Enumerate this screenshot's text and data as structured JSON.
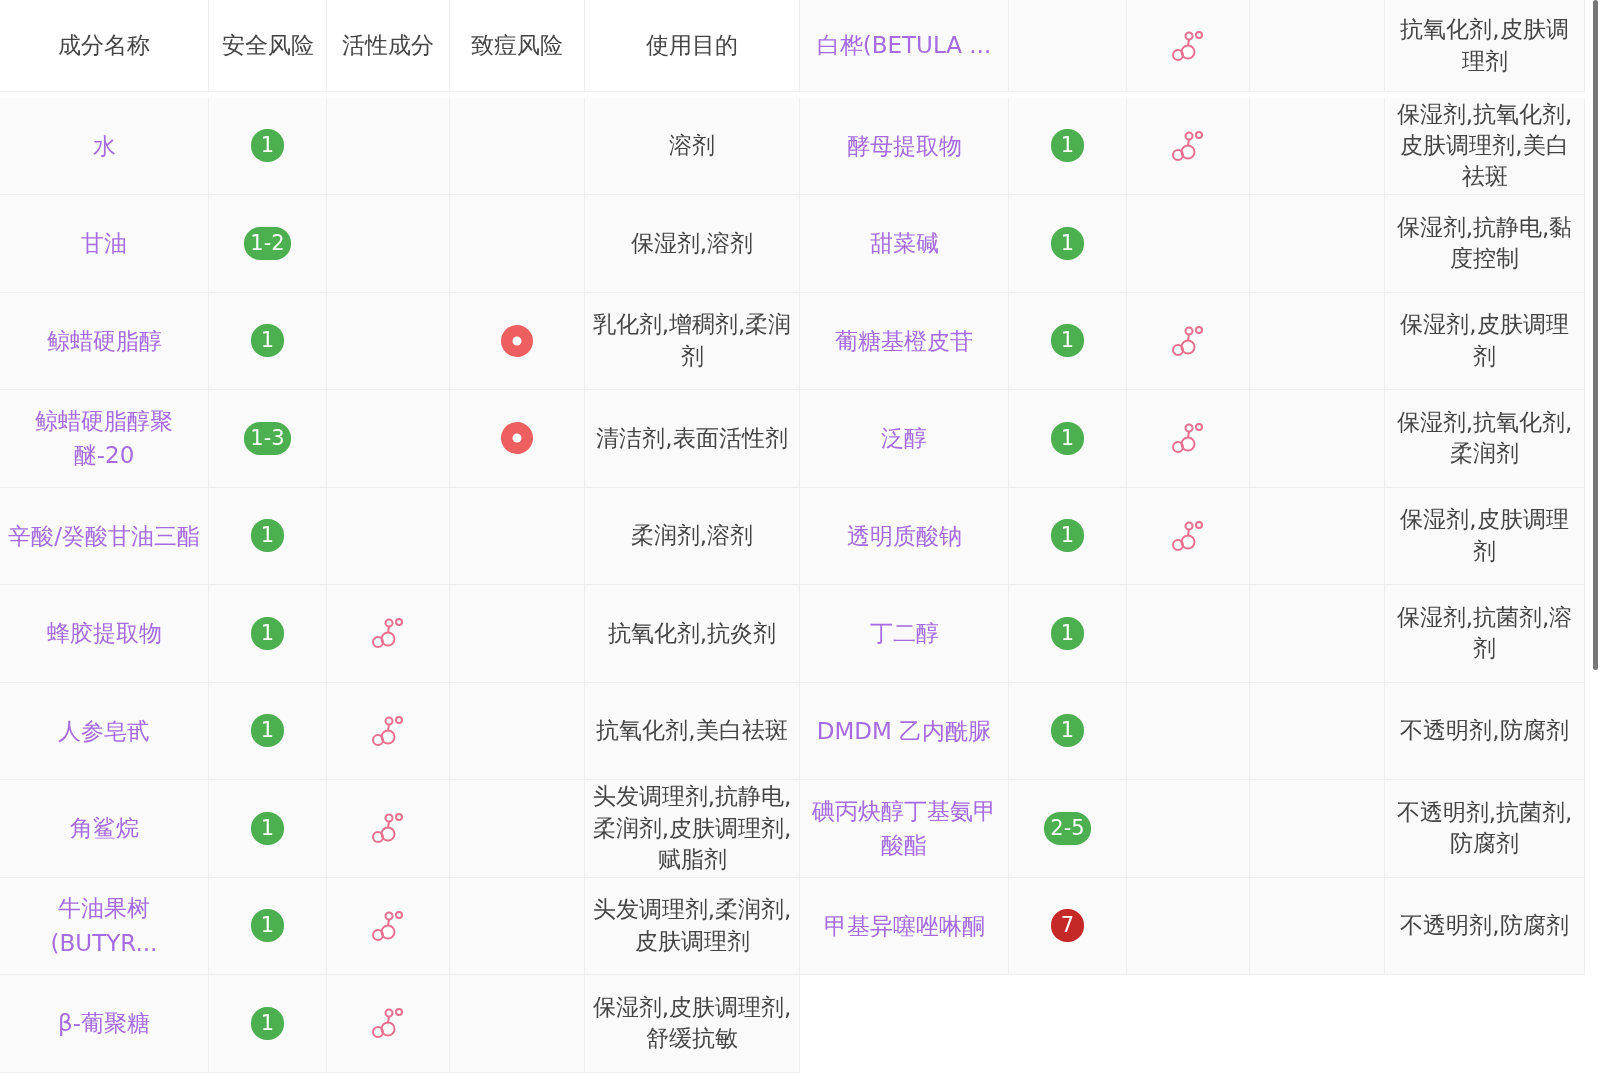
{
  "columns": [
    "成分名称",
    "安全风险",
    "活性成分",
    "致痘风险",
    "使用目的"
  ],
  "left_rows": [
    {
      "name": "水",
      "safety": {
        "text": "1",
        "color": "#4caf50"
      },
      "active": false,
      "acne_risk": false,
      "purpose": "溶剂"
    },
    {
      "name": "甘油",
      "safety": {
        "text": "1-2",
        "color": "#4caf50"
      },
      "active": false,
      "acne_risk": false,
      "purpose": "保湿剂,溶剂"
    },
    {
      "name": "鲸蜡硬脂醇",
      "safety": {
        "text": "1",
        "color": "#4caf50"
      },
      "active": false,
      "acne_risk": true,
      "purpose": "乳化剂,增稠剂,柔润剂"
    },
    {
      "name": "鲸蜡硬脂醇聚醚-20",
      "safety": {
        "text": "1-3",
        "color": "#4caf50"
      },
      "active": false,
      "acne_risk": true,
      "purpose": "清洁剂,表面活性剂"
    },
    {
      "name": "辛酸/癸酸甘油三酯",
      "safety": {
        "text": "1",
        "color": "#4caf50"
      },
      "active": false,
      "acne_risk": false,
      "purpose": "柔润剂,溶剂"
    },
    {
      "name": "蜂胶提取物",
      "safety": {
        "text": "1",
        "color": "#4caf50"
      },
      "active": true,
      "acne_risk": false,
      "purpose": "抗氧化剂,抗炎剂"
    },
    {
      "name": "人参皂甙",
      "safety": {
        "text": "1",
        "color": "#4caf50"
      },
      "active": true,
      "acne_risk": false,
      "purpose": "抗氧化剂,美白祛斑"
    },
    {
      "name": "角鲨烷",
      "safety": {
        "text": "1",
        "color": "#4caf50"
      },
      "active": true,
      "acne_risk": false,
      "purpose": "头发调理剂,抗静电,柔润剂,皮肤调理剂,赋脂剂"
    },
    {
      "name": "牛油果树(BUTYR...",
      "safety": {
        "text": "1",
        "color": "#4caf50"
      },
      "active": true,
      "acne_risk": false,
      "purpose": "头发调理剂,柔润剂,皮肤调理剂"
    },
    {
      "name": "β-葡聚糖",
      "safety": {
        "text": "1",
        "color": "#4caf50"
      },
      "active": true,
      "acne_risk": false,
      "purpose": "保湿剂,皮肤调理剂,舒缓抗敏"
    }
  ],
  "right_rows": [
    {
      "name": "白桦(BETULA ...",
      "active": true,
      "acne_risk": false,
      "purpose": "抗氧化剂,皮肤调理剂"
    },
    {
      "name": "酵母提取物",
      "safety": {
        "text": "1",
        "color": "#4caf50"
      },
      "active": true,
      "acne_risk": false,
      "purpose": "保湿剂,抗氧化剂,皮肤调理剂,美白祛斑"
    },
    {
      "name": "甜菜碱",
      "safety": {
        "text": "1",
        "color": "#4caf50"
      },
      "active": false,
      "acne_risk": false,
      "purpose": "保湿剂,抗静电,黏度控制"
    },
    {
      "name": "葡糖基橙皮苷",
      "safety": {
        "text": "1",
        "color": "#4caf50"
      },
      "active": true,
      "acne_risk": false,
      "purpose": "保湿剂,皮肤调理剂"
    },
    {
      "name": "泛醇",
      "safety": {
        "text": "1",
        "color": "#4caf50"
      },
      "active": true,
      "acne_risk": false,
      "purpose": "保湿剂,抗氧化剂,柔润剂"
    },
    {
      "name": "透明质酸钠",
      "safety": {
        "text": "1",
        "color": "#4caf50"
      },
      "active": true,
      "acne_risk": false,
      "purpose": "保湿剂,皮肤调理剂"
    },
    {
      "name": "丁二醇",
      "safety": {
        "text": "1",
        "color": "#4caf50"
      },
      "active": false,
      "acne_risk": false,
      "purpose": "保湿剂,抗菌剂,溶剂"
    },
    {
      "name": "DMDM 乙内酰脲",
      "safety": {
        "text": "1",
        "color": "#4caf50"
      },
      "active": false,
      "acne_risk": false,
      "purpose": "不透明剂,防腐剂"
    },
    {
      "name": "碘丙炔醇丁基氨甲酸酯",
      "safety": {
        "text": "2-5",
        "color": "#4caf50"
      },
      "active": false,
      "acne_risk": false,
      "purpose": "不透明剂,抗菌剂,防腐剂"
    },
    {
      "name": "甲基异噻唑啉酮",
      "safety": {
        "text": "7",
        "color": "#c62828"
      },
      "active": false,
      "acne_risk": false,
      "purpose": "不透明剂,防腐剂"
    }
  ]
}
